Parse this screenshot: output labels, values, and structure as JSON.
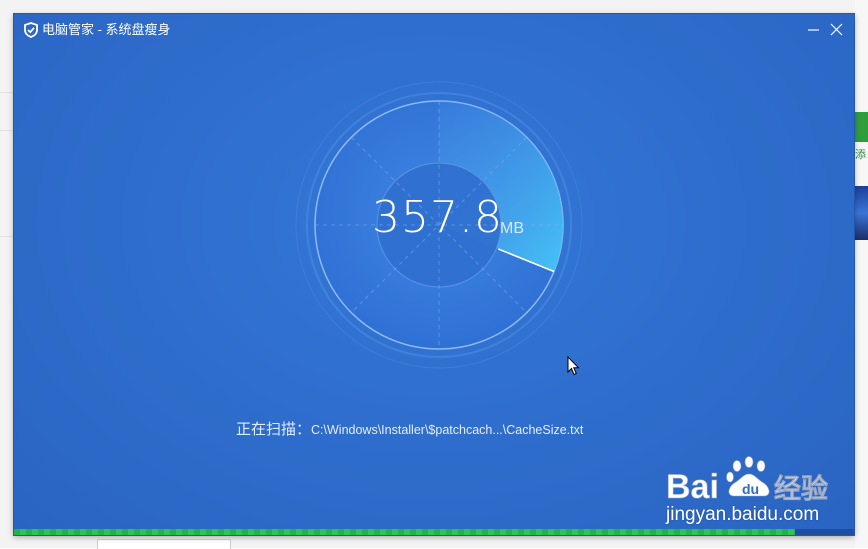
{
  "window": {
    "title": "电脑管家 - 系统盘瘦身",
    "app_icon": "shield-icon",
    "minimize_icon": "minimize-icon",
    "close_icon": "close-icon"
  },
  "scan": {
    "size_value": "357.8",
    "size_unit": "MB",
    "status_label": "正在扫描：",
    "current_path": "C:\\Windows\\Installer\\$patchcach...\\CacheSize.txt",
    "progress": 0.93
  },
  "background": {
    "side_text": "添"
  },
  "watermark": {
    "brand": "Bai du 经验",
    "url": "jingyan.baidu.com"
  },
  "colors": {
    "window_bg": "#2d6ac9",
    "accent": "#39b4f2",
    "progress": "#23b24a"
  }
}
